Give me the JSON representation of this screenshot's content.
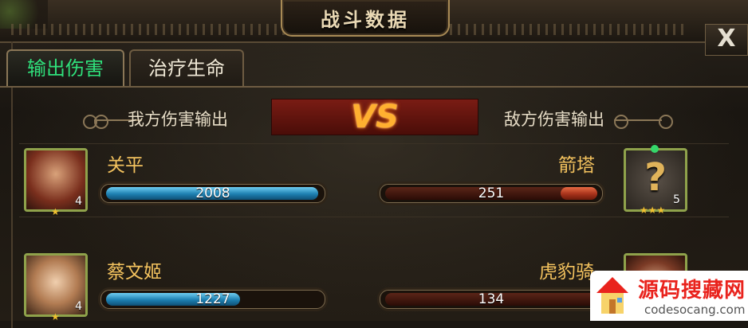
{
  "window": {
    "title": "战斗数据",
    "close_label": "X"
  },
  "tabs": [
    {
      "label": "输出伤害",
      "active": true
    },
    {
      "label": "治疗生命",
      "active": false
    }
  ],
  "header": {
    "left_label": "我方伤害输出",
    "vs_label": "VS",
    "right_label": "敌方伤害输出"
  },
  "rows": [
    {
      "ally": {
        "name": "关平",
        "level": "4",
        "stars": 1,
        "damage": "2008",
        "bar_fraction": 1.0
      },
      "enemy": {
        "name": "箭塔",
        "level": "5",
        "stars": 3,
        "damage": "251",
        "bar_fraction": 0.2
      }
    },
    {
      "ally": {
        "name": "蔡文姬",
        "level": "4",
        "stars": 1,
        "damage": "1227",
        "bar_fraction": 0.61
      },
      "enemy": {
        "name": "虎豹骑",
        "damage": "134",
        "bar_fraction": 0.1
      }
    }
  ],
  "watermark": {
    "title": "源码搜藏网",
    "url": "codesocang.com"
  },
  "colors": {
    "active_tab": "#2fe07b",
    "name_gold": "#f3c25e",
    "ally_bar": "#1d7fb0",
    "enemy_bar": "#a6321b",
    "vs_orange": "#ffb030"
  }
}
